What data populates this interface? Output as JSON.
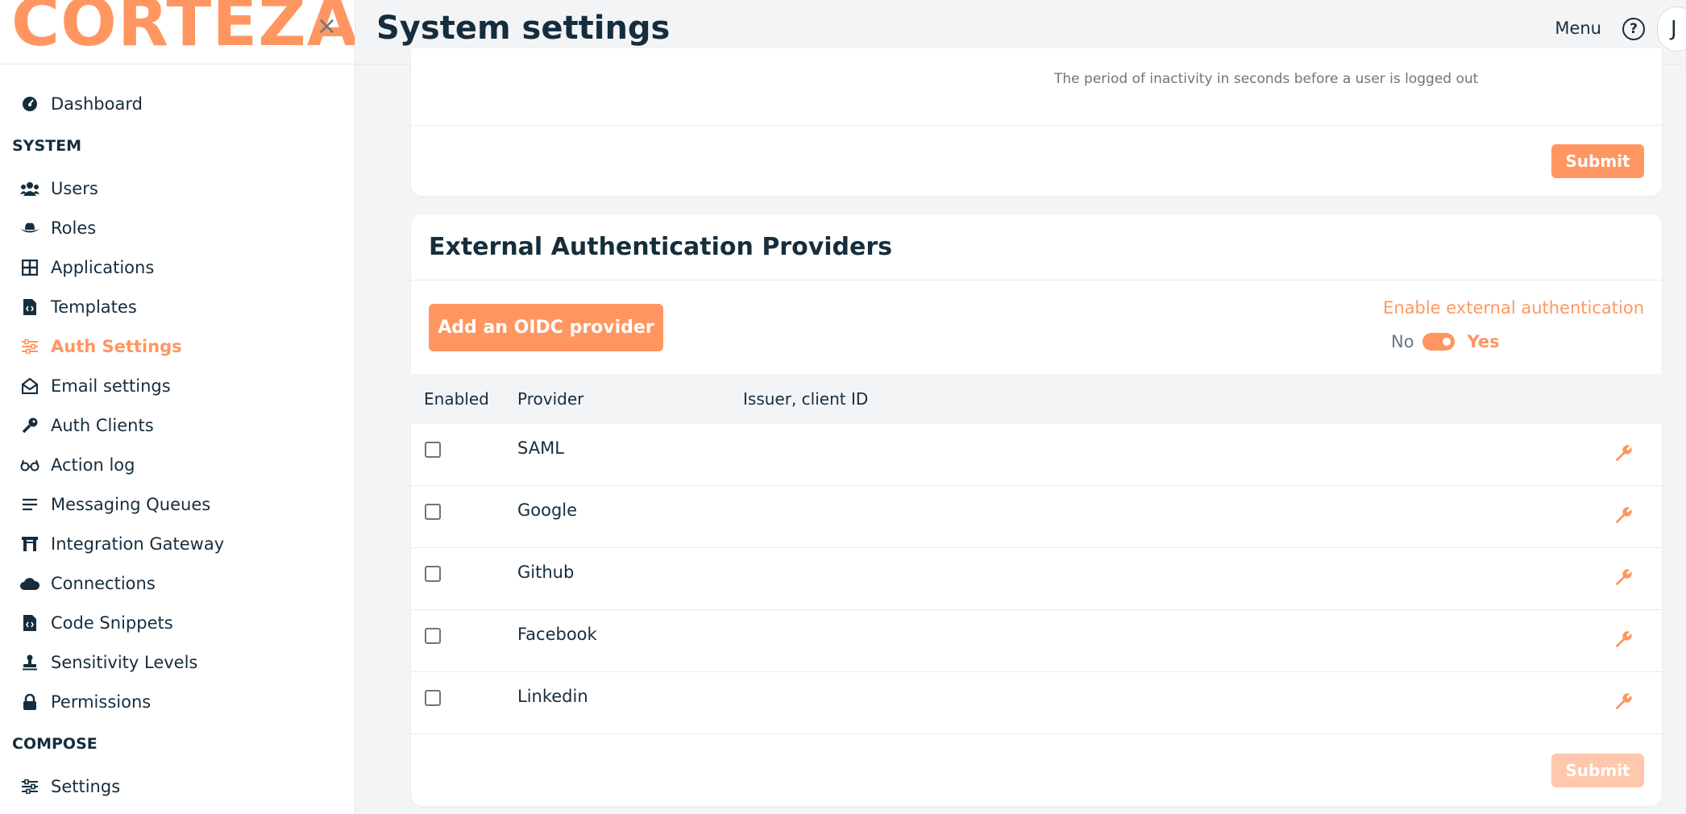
{
  "brand": {
    "logo_text": "CORTEZA",
    "close_glyph": "×"
  },
  "sidebar": {
    "top_items": [
      {
        "label": "Dashboard",
        "icon": "dashboard-icon"
      }
    ],
    "sections": [
      {
        "title": "SYSTEM",
        "items": [
          {
            "label": "Users",
            "icon": "users-icon"
          },
          {
            "label": "Roles",
            "icon": "hat-icon"
          },
          {
            "label": "Applications",
            "icon": "grid-icon"
          },
          {
            "label": "Templates",
            "icon": "file-code-icon"
          },
          {
            "label": "Auth Settings",
            "icon": "sliders-icon",
            "active": true
          },
          {
            "label": "Email settings",
            "icon": "envelope-open-icon"
          },
          {
            "label": "Auth Clients",
            "icon": "key-icon"
          },
          {
            "label": "Action log",
            "icon": "glasses-icon"
          },
          {
            "label": "Messaging Queues",
            "icon": "list-icon"
          },
          {
            "label": "Integration Gateway",
            "icon": "gateway-icon"
          },
          {
            "label": "Connections",
            "icon": "cloud-icon"
          },
          {
            "label": "Code Snippets",
            "icon": "file-code-icon"
          },
          {
            "label": "Sensitivity Levels",
            "icon": "stamp-icon"
          },
          {
            "label": "Permissions",
            "icon": "lock-icon"
          }
        ]
      },
      {
        "title": "COMPOSE",
        "items": [
          {
            "label": "Settings",
            "icon": "sliders-icon"
          }
        ]
      }
    ]
  },
  "header": {
    "title": "System settings",
    "menu_label": "Menu",
    "help_glyph": "?",
    "avatar_initial": "J"
  },
  "session_card": {
    "hint": "The period of inactivity in seconds before a user is logged out",
    "submit_label": "Submit"
  },
  "external_auth": {
    "title": "External Authentication Providers",
    "add_button_label": "Add an OIDC provider",
    "enable_label": "Enable external authentication",
    "toggle_no": "No",
    "toggle_yes": "Yes",
    "toggle_value": true,
    "columns": {
      "enabled": "Enabled",
      "provider": "Provider",
      "issuer": "Issuer, client ID"
    },
    "providers": [
      {
        "name": "SAML",
        "enabled": false
      },
      {
        "name": "Google",
        "enabled": false
      },
      {
        "name": "Github",
        "enabled": false
      },
      {
        "name": "Facebook",
        "enabled": false
      },
      {
        "name": "Linkedin",
        "enabled": false
      }
    ],
    "submit_label": "Submit"
  },
  "colors": {
    "accent": "#ff9661",
    "text": "#162d3d",
    "muted": "#6b7680"
  }
}
